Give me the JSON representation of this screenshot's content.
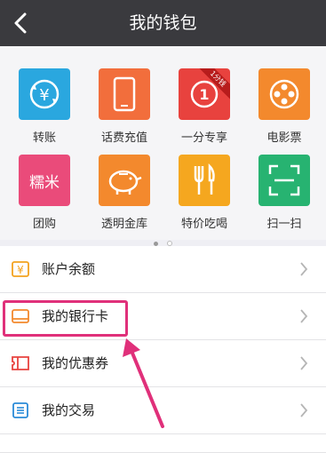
{
  "header": {
    "title": "我的钱包"
  },
  "grid": {
    "tiles": [
      {
        "label": "转账",
        "icon": "exchange-icon",
        "color": "#2aa7df"
      },
      {
        "label": "话费充值",
        "icon": "phone-icon",
        "color": "#f26e3c"
      },
      {
        "label": "一分专享",
        "icon": "one-cent-icon",
        "color": "#e8423e",
        "badge": "1分钱"
      },
      {
        "label": "电影票",
        "icon": "film-reel-icon",
        "color": "#f3892d"
      },
      {
        "label": "团购",
        "icon": "nuomi-icon",
        "color": "#ea4b7a",
        "text": "糯米"
      },
      {
        "label": "透明金库",
        "icon": "piggy-bank-icon",
        "color": "#f3892d"
      },
      {
        "label": "特价吃喝",
        "icon": "fork-knife-icon",
        "color": "#f5a71f"
      },
      {
        "label": "扫一扫",
        "icon": "scan-icon",
        "color": "#27b371"
      }
    ],
    "page_indicator": {
      "pages": 2,
      "current": 1
    }
  },
  "menu": [
    {
      "label": "账户余额",
      "icon": "yen-icon",
      "color": "#f3a21e"
    },
    {
      "label": "我的银行卡",
      "icon": "bank-card-icon",
      "color": "#f3892d"
    },
    {
      "label": "我的优惠券",
      "icon": "coupon-icon",
      "color": "#e8423e"
    },
    {
      "label": "我的交易",
      "icon": "list-icon",
      "color": "#2a8bd8"
    }
  ],
  "colors": {
    "header": "#3a3a3e",
    "highlight": "#e0307a"
  }
}
